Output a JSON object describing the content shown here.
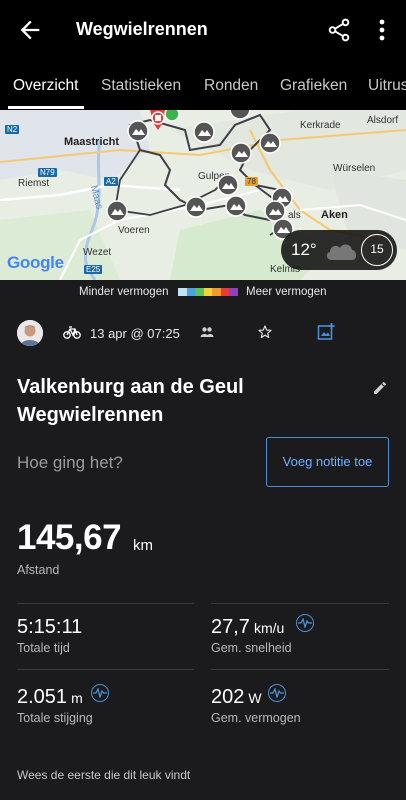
{
  "appbar": {
    "title": "Wegwielrennen",
    "icons": [
      "arrow-left-icon",
      "share-icon",
      "more-vert-icon"
    ]
  },
  "tabs": [
    {
      "label": "Overzicht",
      "active": true
    },
    {
      "label": "Statistieken",
      "active": false
    },
    {
      "label": "Ronden",
      "active": false
    },
    {
      "label": "Grafieken",
      "active": false
    },
    {
      "label": "Uitrus",
      "active": false
    }
  ],
  "map": {
    "labels": {
      "maastricht": "Maastricht",
      "kerkrade": "Kerkrade",
      "alsdorf": "Alsdorf",
      "riemst": "Riemst",
      "maas": "Maas",
      "gulpen": "Gulpen",
      "wurselen": "Würselen",
      "aken": "Aken",
      "voeren": "Voeren",
      "wezet": "Wezet",
      "kelmis": "Kelmis",
      "ouvaals": "als",
      "n2": "N2",
      "n79": "N79",
      "a2": "A2",
      "e25": "E25",
      "n278": "78"
    },
    "attribution": "Google"
  },
  "weather": {
    "temperature": "12°",
    "wind": "15",
    "icon": "cloud-icon"
  },
  "legend": {
    "minder": "Minder vermogen",
    "meer": "Meer vermogen",
    "colors": [
      "#bfe3f5",
      "#4aa3e0",
      "#5cc45c",
      "#f2d33a",
      "#f29a2e",
      "#e53b3b",
      "#8e3fc2"
    ]
  },
  "activity": {
    "date": "13 apr @ 07:25",
    "title": "Valkenburg aan de Geul Wegwielrennen",
    "prompt": "Hoe ging het?",
    "note_button": "Voeg notitie toe"
  },
  "stats": {
    "distance": {
      "value": "145,67",
      "unit": "km",
      "label": "Afstand"
    },
    "total_time": {
      "value": "5:15:11",
      "label": "Totale tijd"
    },
    "avg_speed": {
      "value": "27,7",
      "unit": "km/u",
      "label": "Gem. snelheid"
    },
    "ascent": {
      "value": "2.051",
      "unit": "m",
      "label": "Totale stijging"
    },
    "avg_power": {
      "value": "202",
      "unit": "W",
      "label": "Gem. vermogen"
    }
  },
  "likes": "Wees de eerste die dit leuk vindt"
}
